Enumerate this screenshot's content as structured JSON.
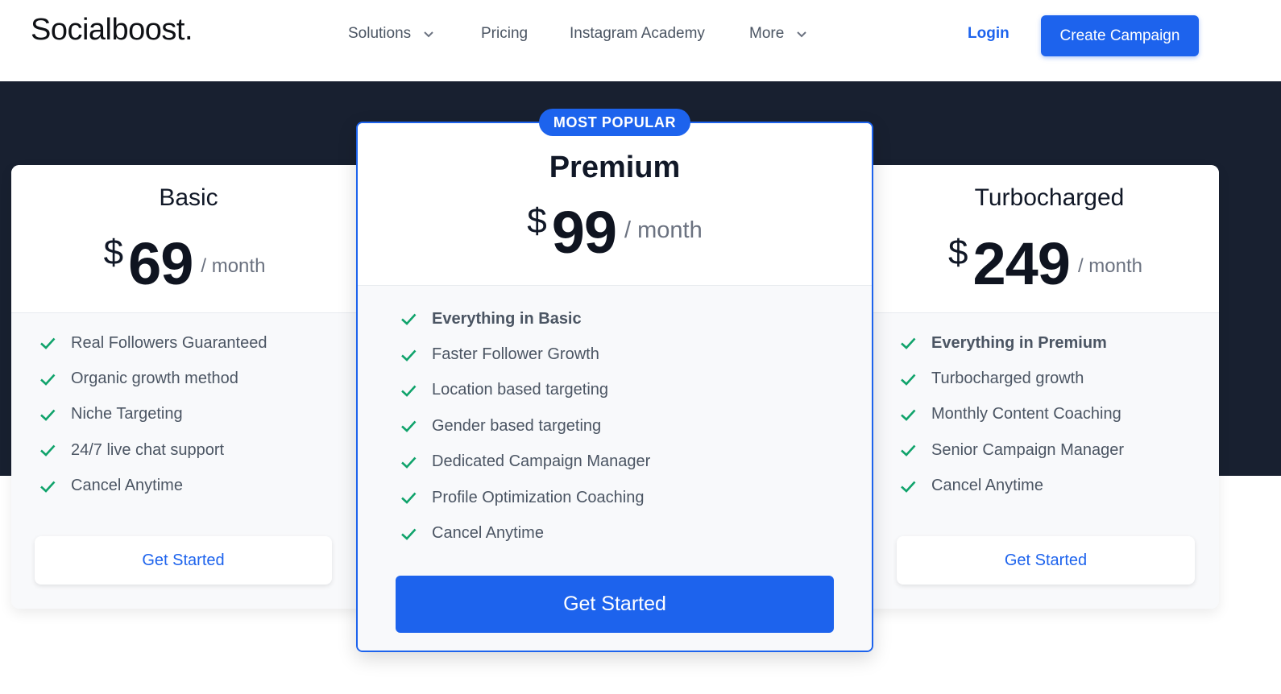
{
  "header": {
    "logo": "Socialboost.",
    "nav": [
      "Solutions",
      "Pricing",
      "Instagram Academy",
      "More"
    ],
    "login": "Login",
    "cta": "Create Campaign"
  },
  "colors": {
    "accent": "#1d63ed",
    "dark_band": "#182030",
    "check": "#10a36b"
  },
  "plans": [
    {
      "name": "Basic",
      "currency": "$",
      "price": "69",
      "period": "/ month",
      "features": [
        "Real Followers Guaranteed",
        "Organic growth method",
        "Niche Targeting",
        "24/7 live chat support",
        "Cancel Anytime"
      ],
      "button": "Get Started"
    },
    {
      "badge": "MOST POPULAR",
      "name": "Premium",
      "currency": "$",
      "price": "99",
      "period": "/ month",
      "features": [
        "Everything in Basic",
        "Faster Follower Growth",
        "Location based targeting",
        "Gender based targeting",
        "Dedicated Campaign Manager",
        "Profile Optimization Coaching",
        "Cancel Anytime"
      ],
      "button": "Get Started"
    },
    {
      "name": "Turbocharged",
      "currency": "$",
      "price": "249",
      "period": "/ month",
      "features": [
        "Everything in Premium",
        "Turbocharged growth",
        "Monthly Content Coaching",
        "Senior Campaign Manager",
        "Cancel Anytime"
      ],
      "button": "Get Started"
    }
  ]
}
